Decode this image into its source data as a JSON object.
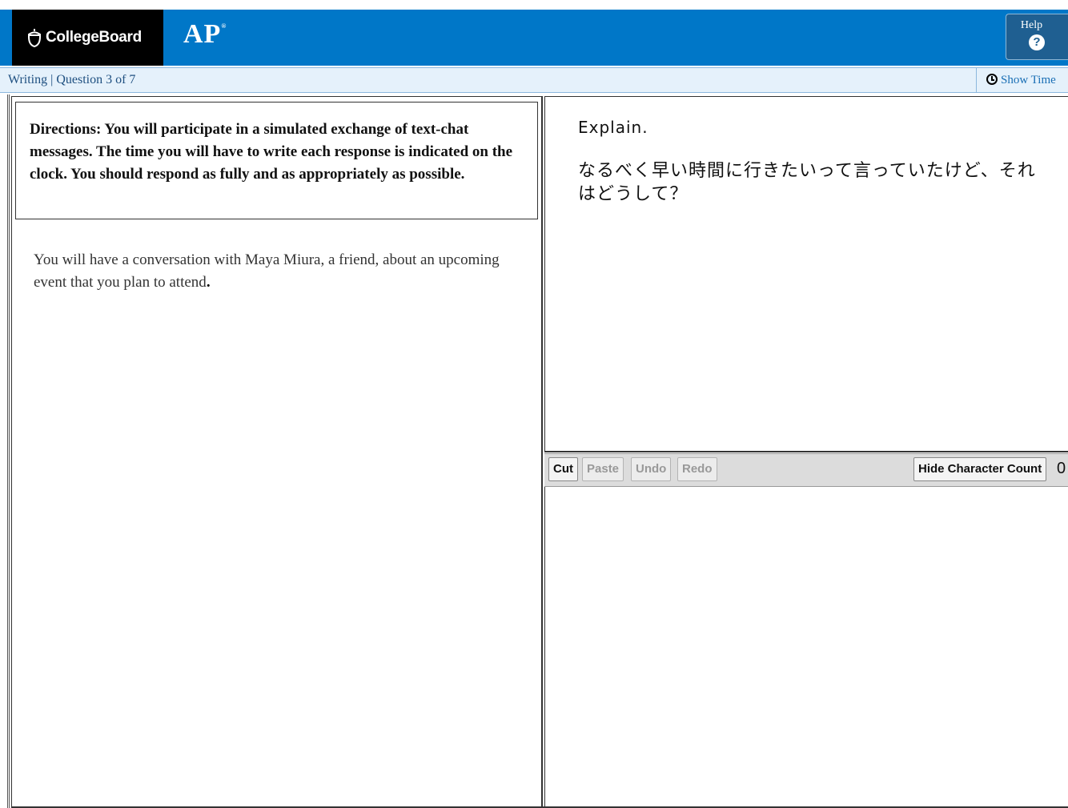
{
  "header": {
    "brand": "CollegeBoard",
    "program": "AP",
    "program_mark": "®",
    "help_label": "Help",
    "help_icon": "?"
  },
  "subbar": {
    "breadcrumb": "Writing | Question 3 of 7",
    "show_time_label": "Show Time"
  },
  "left": {
    "directions": "Directions: You will participate in a simulated exchange of text-chat messages. The time you will have to write each response is indicated on the clock. You should respond as fully and as appropriately as possible.",
    "intro_main": "You will have a conversation with Maya Miura, a friend, about an upcoming event that you plan to attend",
    "intro_period": "."
  },
  "prompt": {
    "instruction": "Explain.",
    "message": "なるべく早い時間に行きたいって言っていたけど、それはどうして？"
  },
  "toolbar": {
    "cut": "Cut",
    "paste": "Paste",
    "undo": "Undo",
    "redo": "Redo",
    "hide_count": "Hide Character Count",
    "char_count": "0"
  },
  "answer": {
    "value": ""
  },
  "colors": {
    "header_blue": "#0077c8",
    "subbar_bg": "#e5f1fb",
    "help_bg": "#1f5f91"
  }
}
